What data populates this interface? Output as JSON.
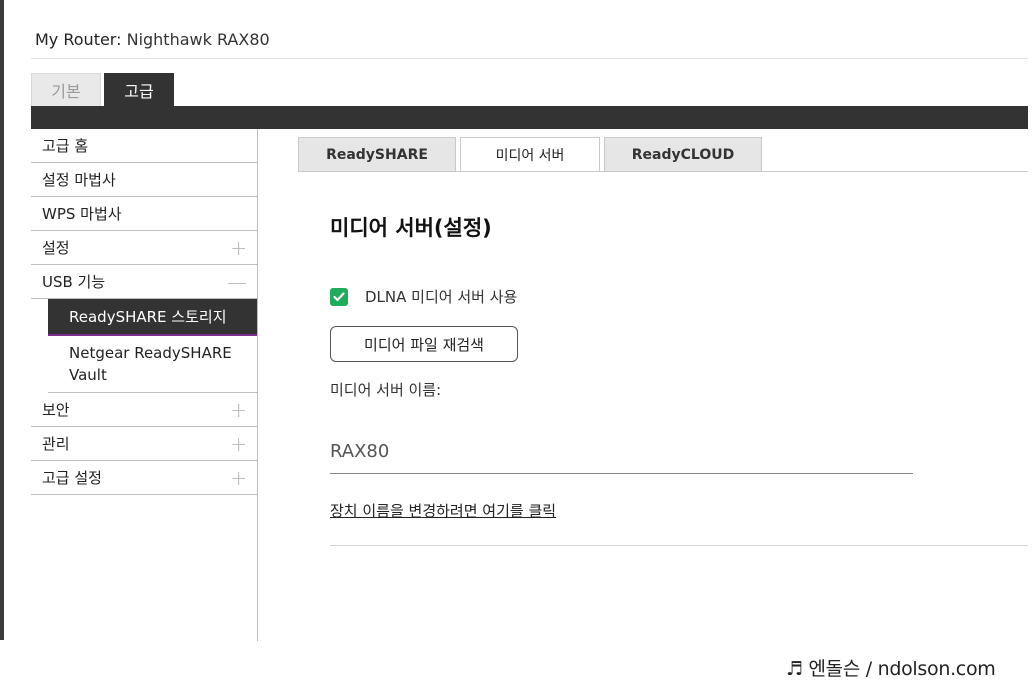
{
  "header": {
    "prefix": "My Router:",
    "model": "Nighthawk RAX80"
  },
  "top_tabs": {
    "basic": "기본",
    "advanced": "고급"
  },
  "sidebar": {
    "items": [
      {
        "label": "고급 홈",
        "sign": ""
      },
      {
        "label": "설정 마법사",
        "sign": ""
      },
      {
        "label": "WPS 마법사",
        "sign": ""
      },
      {
        "label": "설정",
        "sign": "+"
      },
      {
        "label": "USB 기능",
        "sign": "—"
      }
    ],
    "sub_active": "ReadySHARE 스토리지",
    "sub_other": "Netgear ReadySHARE Vault",
    "items_after": [
      {
        "label": "보안",
        "sign": "+"
      },
      {
        "label": "관리",
        "sign": "+"
      },
      {
        "label": "고급 설정",
        "sign": "+"
      }
    ]
  },
  "subtabs": {
    "readyshare": "ReadySHARE",
    "media": "미디어 서버",
    "readycloud": "ReadyCLOUD"
  },
  "main": {
    "heading": "미디어 서버(설정)",
    "dlna_label": "DLNA 미디어 서버 사용",
    "dlna_checked": true,
    "rescan_button": "미디어 파일 재검색",
    "server_name_label": "미디어 서버 이름:",
    "server_name_value": "RAX80",
    "rename_link": "장치 이름을 변경하려면 여기를 클릭"
  },
  "watermark": "♬ 엔돌슨 / ndolson.com",
  "colors": {
    "dark_bar": "#333333",
    "checkbox": "#1fad5b",
    "active_underline": "#7a2f8c"
  }
}
